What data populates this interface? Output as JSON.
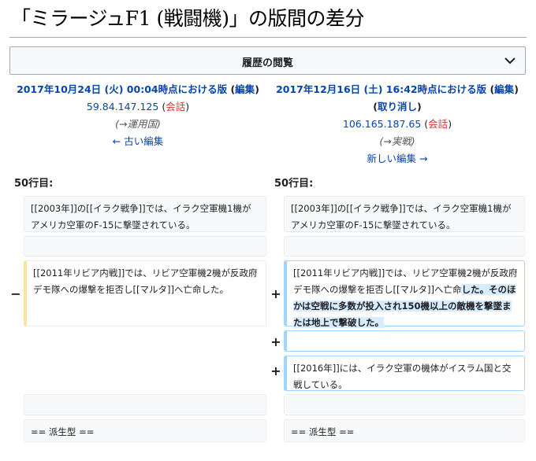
{
  "page": {
    "title": "「ミラージュF1 (戦闘機)」の版間の差分"
  },
  "history": {
    "label": "履歴の閲覧",
    "icon": "chevron-down-icon"
  },
  "left": {
    "rev_date": "2017年10月24日 (火) 00:04時点における版",
    "edit_open": " (",
    "edit_label": "編集",
    "edit_close": ")",
    "user_ip": "59.84.147.125",
    "talk_open": " (",
    "talk_label": "会話",
    "talk_close": ")",
    "summary": "(→運用国)",
    "nav": "← 古い編集",
    "lineno": "50行目:"
  },
  "right": {
    "rev_date": "2017年12月16日 (土) 16:42時点における版",
    "edit_open": " (",
    "edit_label": "編集",
    "edit_close": ")",
    "undo_open": "(",
    "undo_label": "取り消し",
    "undo_close": ")",
    "user_ip": "106.165.187.65",
    "talk_open": " (",
    "talk_label": "会話",
    "talk_close": ")",
    "summary": "(→実戦)",
    "nav": "新しい編集 →",
    "lineno": "50行目:"
  },
  "diff": {
    "ctx1": "[[2003年]]の[[イラク戦争]]では、イラク空軍機1機がアメリカ空軍のF-15に撃墜されている。",
    "del_marker": "−",
    "del_text": "[[2011年リビア内戦]]では、リビア空軍機2機が反政府デモ隊への爆撃を拒否し[[マルタ]]へ亡命した。",
    "add_marker": "+",
    "add_text_plain": "[[2011年リビア内戦]]では、リビア空軍機2機が反政府デモ隊への爆撃を拒否し[[マルタ]]へ亡命",
    "add_text_ins": "した。そのほかは空戦に多数が投入され150機以上の敵機を撃墜または地上で撃破した。",
    "add2_marker": "+",
    "add3_marker": "+",
    "add3_text": "[[2016年]]には、イラク空軍の機体がイスラム国と交戦している。",
    "ctx_last": "== 派生型 =="
  },
  "colors": {
    "link": "#0645ad",
    "red_link": "#d33",
    "deleted_border": "#ffe49c",
    "added_border": "#a3d3ff",
    "inserted_bg": "#d8ecff"
  }
}
